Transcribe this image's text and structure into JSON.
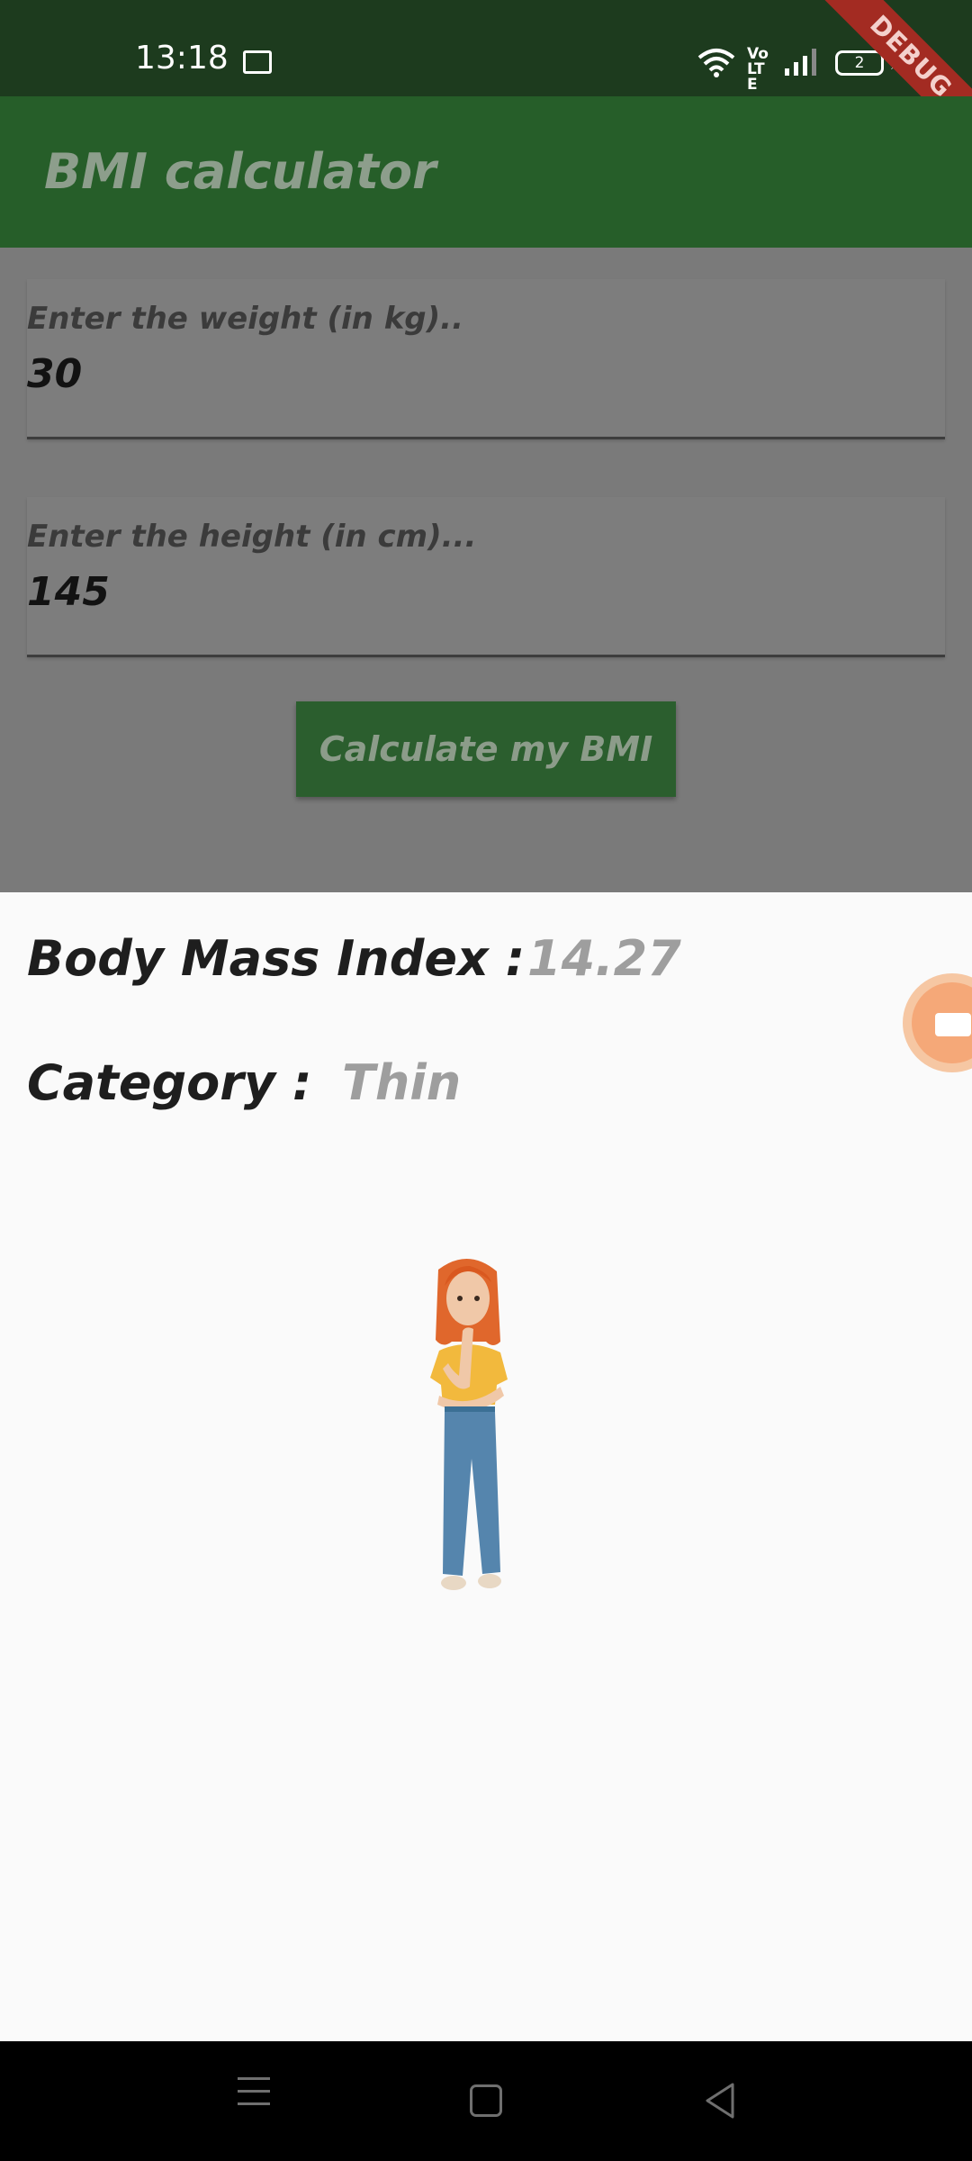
{
  "status_bar": {
    "time": "13:18",
    "battery": "2",
    "network": "Vo LTE"
  },
  "debug_banner": "DEBUG",
  "app_bar": {
    "title": "BMI calculator"
  },
  "form": {
    "weight": {
      "label": "Enter the weight (in kg)..",
      "value": "30"
    },
    "height": {
      "label": "Enter the height (in cm)...",
      "value": "145"
    },
    "calculate_label": "Calculate my BMI"
  },
  "result": {
    "bmi_label": "Body Mass Index :",
    "bmi_value": "14.27",
    "category_label": "Category :",
    "category_value": "Thin"
  },
  "colors": {
    "app_bar": "#265e29",
    "button": "#2b5e2e",
    "status_bar": "#1d3b1e",
    "scrim": "#7a7a7a",
    "sheet": "#fafafa"
  },
  "icons": [
    "outlook-icon",
    "wifi-icon",
    "signal-icon",
    "battery-icon",
    "charging-icon",
    "screen-recorder-icon",
    "menu-icon",
    "home-icon",
    "back-icon"
  ]
}
